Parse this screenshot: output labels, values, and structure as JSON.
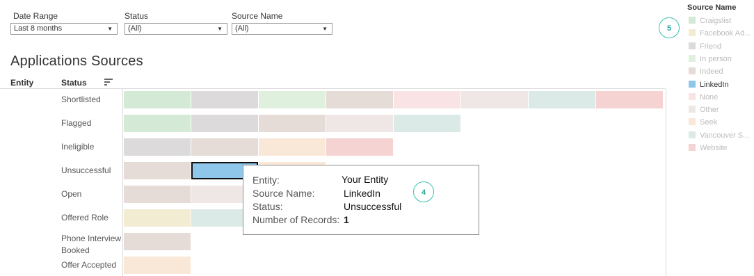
{
  "filters": {
    "date_range": {
      "label": "Date Range",
      "value": "Last 8 months"
    },
    "status": {
      "label": "Status",
      "value": "(All)"
    },
    "source_name": {
      "label": "Source Name",
      "value": "(All)"
    }
  },
  "chart_title": "Applications Sources",
  "columns": {
    "entity": "Entity",
    "status": "Status"
  },
  "tooltip": {
    "entity_label": "Entity:",
    "entity_value": "Your Entity",
    "source_label": "Source Name:",
    "source_value": "LinkedIn",
    "status_label": "Status:",
    "status_value": "Unsuccessful",
    "records_label": "Number of Records:",
    "records_value": "1"
  },
  "badges": {
    "tooltip_badge": "4",
    "legend_badge": "5"
  },
  "legend": {
    "title": "Source Name",
    "items": [
      {
        "label": "Craigslist",
        "color": "#d4ead6",
        "active": false
      },
      {
        "label": "Facebook Ad...",
        "color": "#f2ecd2",
        "active": false
      },
      {
        "label": "Friend",
        "color": "#dcdadb",
        "active": false
      },
      {
        "label": "In person",
        "color": "#dff0df",
        "active": false
      },
      {
        "label": "Indeed",
        "color": "#e5dbd7",
        "active": false
      },
      {
        "label": "LinkedIn",
        "color": "#8ec7ea",
        "active": true
      },
      {
        "label": "None",
        "color": "#f9e3e4",
        "active": false
      },
      {
        "label": "Other",
        "color": "#efe7e6",
        "active": false
      },
      {
        "label": "Seek",
        "color": "#f9e8d8",
        "active": false
      },
      {
        "label": "Vancouver S...",
        "color": "#dbe9e7",
        "active": false
      },
      {
        "label": "Website",
        "color": "#f5d3d3",
        "active": false
      }
    ]
  },
  "chart_data": {
    "type": "table",
    "title": "Applications Sources",
    "row_header": "Status",
    "rows": [
      {
        "status": "Shortlisted",
        "sources": [
          "Craigslist",
          "Friend",
          "In person",
          "Indeed",
          "None",
          "Other",
          "Vancouver S...",
          "Website"
        ]
      },
      {
        "status": "Flagged",
        "sources": [
          "Craigslist",
          "Friend",
          "Indeed",
          "Other",
          "Vancouver S..."
        ]
      },
      {
        "status": "Ineligible",
        "sources": [
          "Friend",
          "Indeed",
          "Seek",
          "Website"
        ]
      },
      {
        "status": "Unsuccessful",
        "sources": [
          "Indeed",
          "LinkedIn",
          "Seek"
        ]
      },
      {
        "status": "Open",
        "sources": [
          "Indeed",
          "Other"
        ]
      },
      {
        "status": "Offered Role",
        "sources": [
          "Facebook Ad...",
          "Vancouver S..."
        ]
      },
      {
        "status": "Phone Interview Booked",
        "sources": [
          "Indeed"
        ]
      },
      {
        "status": "Offer Accepted",
        "sources": [
          "Seek"
        ]
      }
    ],
    "highlighted": {
      "status": "Unsuccessful",
      "source": "LinkedIn"
    }
  }
}
